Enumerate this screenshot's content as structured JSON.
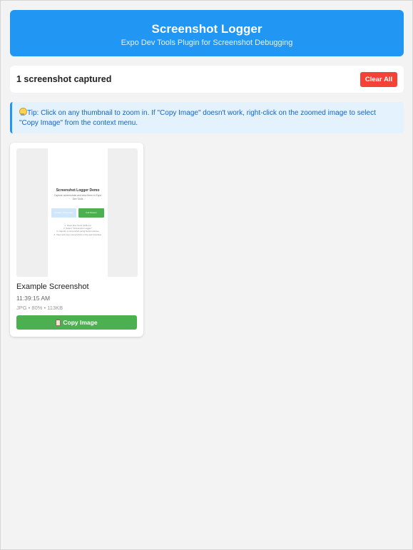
{
  "header": {
    "title": "Screenshot Logger",
    "subtitle": "Expo Dev Tools Plugin for Screenshot Debugging"
  },
  "status": {
    "count_text": "1 screenshot captured",
    "clear_label": "Clear All"
  },
  "tip": {
    "icon": "lightbulb-icon",
    "text": "Tip: Click on any thumbnail to zoom in. If \"Copy Image\" doesn't work, right-click on the zoomed image to select \"Copy Image\" from the context menu."
  },
  "screenshots": [
    {
      "name": "Example Screenshot",
      "time": "11:39:15 AM",
      "meta": "JPG • 80% • 113KB",
      "copy_label": "Copy Image",
      "copy_icon": "clipboard-icon",
      "thumbnail": {
        "title": "Screenshot Logger Demo",
        "description": "Capture screenshots and view them in Expo Dev Tools",
        "button1": "Capture Screenshot",
        "button2": "Full Screen",
        "steps": [
          "1. Open Dev Tools (shift+m)",
          "2. Select \"Screenshot Logger\"",
          "3. Capture a screenshot using buttons above",
          "4. View and copy screenshots in the web interface"
        ]
      }
    }
  ],
  "colors": {
    "header_bg": "#2196f3",
    "clear_btn": "#f44336",
    "copy_btn": "#4caf50",
    "tip_bg": "#e3f2fd",
    "tip_text": "#1565c0"
  }
}
